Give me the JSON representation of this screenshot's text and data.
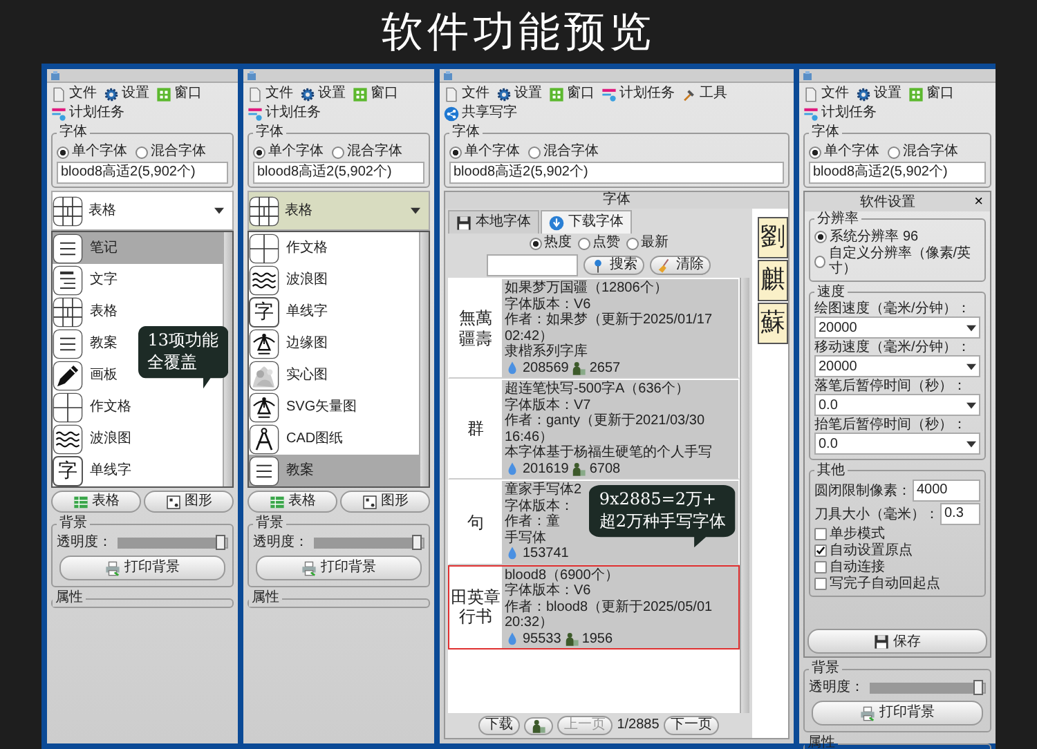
{
  "title": "软件功能预览",
  "panels": [
    {
      "kind": "function_list",
      "toolbar": [
        {
          "kind": "file",
          "label": "文件"
        },
        {
          "kind": "gear",
          "label": "设置"
        },
        {
          "kind": "window",
          "label": "窗口"
        },
        {
          "kind": "task",
          "label": "计划任务"
        }
      ],
      "font": {
        "label": "字体",
        "options": [
          {
            "label": "单个字体",
            "selected": true
          },
          {
            "label": "混合字体",
            "selected": false
          }
        ],
        "value": "blood8高适2(5,902个)"
      },
      "select": {
        "kind": "grid",
        "label": "表格",
        "highlighted": false
      },
      "items": [
        {
          "kind": "lines",
          "label": "笔记",
          "selected": true
        },
        {
          "kind": "text",
          "label": "文字",
          "selected": false
        },
        {
          "kind": "grid",
          "label": "表格",
          "selected": false
        },
        {
          "kind": "lines",
          "label": "教案",
          "selected": false
        },
        {
          "kind": "pencil",
          "label": "画板",
          "selected": false
        },
        {
          "kind": "cross",
          "label": "作文格",
          "selected": false
        },
        {
          "kind": "wave",
          "label": "波浪图",
          "selected": false
        },
        {
          "kind": "char",
          "glyph": "字",
          "label": "单线字",
          "selected": false
        }
      ],
      "buttons": [
        {
          "kind": "table",
          "label": "表格"
        },
        {
          "kind": "shapes",
          "label": "图形"
        }
      ],
      "background": {
        "label": "背景",
        "opacity": "透明度：",
        "level": 0.95,
        "print": "打印背景"
      },
      "properties": "属性",
      "callout": [
        "13项功能",
        "全覆盖"
      ]
    },
    {
      "kind": "function_list",
      "toolbar": [
        {
          "kind": "file",
          "label": "文件"
        },
        {
          "kind": "gear",
          "label": "设置"
        },
        {
          "kind": "window",
          "label": "窗口"
        },
        {
          "kind": "task",
          "label": "计划任务"
        }
      ],
      "font": {
        "label": "字体",
        "options": [
          {
            "label": "单个字体",
            "selected": true
          },
          {
            "label": "混合字体",
            "selected": false
          }
        ],
        "value": "blood8高适2(5,902个)"
      },
      "select": {
        "kind": "grid",
        "label": "表格",
        "highlighted": true
      },
      "items": [
        {
          "kind": "cross",
          "label": "作文格",
          "selected": false
        },
        {
          "kind": "wave",
          "label": "波浪图",
          "selected": false
        },
        {
          "kind": "char",
          "glyph": "字",
          "label": "单线字",
          "selected": false
        },
        {
          "kind": "pen",
          "label": "边缘图",
          "selected": false
        },
        {
          "label": "实心图",
          "selected": false
        },
        {
          "kind": "pen",
          "label": "SVG矢量图",
          "selected": false
        },
        {
          "kind": "compass",
          "label": "CAD图纸",
          "selected": false
        },
        {
          "kind": "lines",
          "label": "教案",
          "selected": true
        }
      ],
      "buttons": [
        {
          "kind": "table",
          "label": "表格"
        },
        {
          "kind": "shapes",
          "label": "图形"
        }
      ],
      "background": {
        "label": "背景",
        "opacity": "透明度：",
        "level": 0.95,
        "print": "打印背景"
      },
      "properties": "属性"
    },
    {
      "kind": "font_library",
      "toolbar": [
        {
          "kind": "file",
          "label": "文件"
        },
        {
          "kind": "gear",
          "label": "设置"
        },
        {
          "kind": "window",
          "label": "窗口"
        },
        {
          "kind": "task",
          "label": "计划任务"
        },
        {
          "kind": "hammer",
          "label": "工具"
        },
        {
          "kind": "share",
          "label": "共享写字"
        }
      ],
      "font": {
        "label": "字体",
        "options": [
          {
            "label": "单个字体",
            "selected": true
          },
          {
            "label": "混合字体",
            "selected": false
          }
        ],
        "value": "blood8高适2(5,902个)"
      },
      "window_title": "字体",
      "tabs": [
        {
          "kind": "floppy",
          "label": "本地字体",
          "selected": false
        },
        {
          "kind": "globe",
          "label": "下载字体",
          "selected": true
        }
      ],
      "sort": [
        {
          "label": "热度",
          "selected": true
        },
        {
          "label": "点赞",
          "selected": false
        },
        {
          "label": "最新",
          "selected": false
        }
      ],
      "search_button": "搜索",
      "clear_button": "清除",
      "fonts": [
        {
          "sample": [
            "無萬",
            "疆壽"
          ],
          "name": "如果梦万国疆（12806个）",
          "version": "字体版本：V6",
          "author": "作者：如果梦（更新于2025/01/17 02:42）",
          "note": "隶楷系列字库",
          "downloads": "208569",
          "likes": "2657",
          "selected": false
        },
        {
          "sample": [
            "群"
          ],
          "name": "超连笔快写-500字A（636个）",
          "version": "字体版本：V7",
          "author": "作者：ganty（更新于2021/03/30 16:46）",
          "note": "本字体基于杨福生硬笔的个人手写",
          "downloads": "201619",
          "likes": "6708",
          "selected": false
        },
        {
          "sample": [
            "句"
          ],
          "name": "童家手写体2",
          "version": "字体版本：",
          "author": "作者：童",
          "note": "手写体",
          "downloads": "153741",
          "selected": false
        },
        {
          "sample": [
            "田英章",
            "行书"
          ],
          "name": "blood8（6900个）",
          "version": "字体版本：V6",
          "author": "作者：blood8（更新于2025/05/01 20:32）",
          "downloads": "95533",
          "likes": "1956",
          "selected": true
        }
      ],
      "glyphs": [
        "劉",
        "麒",
        "蘇"
      ],
      "pager": {
        "download": "下载",
        "prev": "上一页",
        "prev_disabled": true,
        "page": "1/2885",
        "next": "下一页"
      },
      "callout": [
        "9x2885=2万+",
        "超2万种手写字体"
      ]
    },
    {
      "kind": "settings",
      "toolbar": [
        {
          "kind": "file",
          "label": "文件"
        },
        {
          "kind": "gear",
          "label": "设置"
        },
        {
          "kind": "window",
          "label": "窗口"
        },
        {
          "kind": "task",
          "label": "计划任务"
        }
      ],
      "font": {
        "label": "字体",
        "options": [
          {
            "label": "单个字体",
            "selected": true
          },
          {
            "label": "混合字体",
            "selected": false
          }
        ],
        "value": "blood8高适2(5,902个)"
      },
      "dialog": {
        "title": "软件设置",
        "close": "×",
        "resolution": {
          "label": "分辨率",
          "options": [
            {
              "label": "系统分辨率",
              "value": "96",
              "selected": true
            },
            {
              "label": "自定义分辨率（像素/英寸）",
              "selected": false
            }
          ]
        },
        "speed": {
          "label": "速度",
          "fields": [
            {
              "label": "绘图速度（毫米/分钟）：",
              "value": "20000"
            },
            {
              "label": "移动速度（毫米/分钟）：",
              "value": "20000"
            },
            {
              "label": "落笔后暂停时间（秒）：",
              "value": "0.0"
            },
            {
              "label": "抬笔后暂停时间（秒）：",
              "value": "0.0"
            }
          ]
        },
        "other": {
          "label": "其他",
          "fields": [
            {
              "label": "圆闭限制像素：",
              "value": "4000"
            },
            {
              "label": "刀具大小（毫米）：",
              "value": "0.3"
            }
          ],
          "checks": [
            {
              "label": "单步模式",
              "checked": false
            },
            {
              "label": "自动设置原点",
              "checked": true
            },
            {
              "label": "自动连接",
              "checked": false
            },
            {
              "label": "写完子自动回起点",
              "checked": false
            }
          ]
        },
        "save": "保存"
      },
      "background": {
        "label": "背景",
        "opacity": "透明度：",
        "level": 0.95,
        "print": "打印背景"
      },
      "properties": "属性"
    }
  ]
}
